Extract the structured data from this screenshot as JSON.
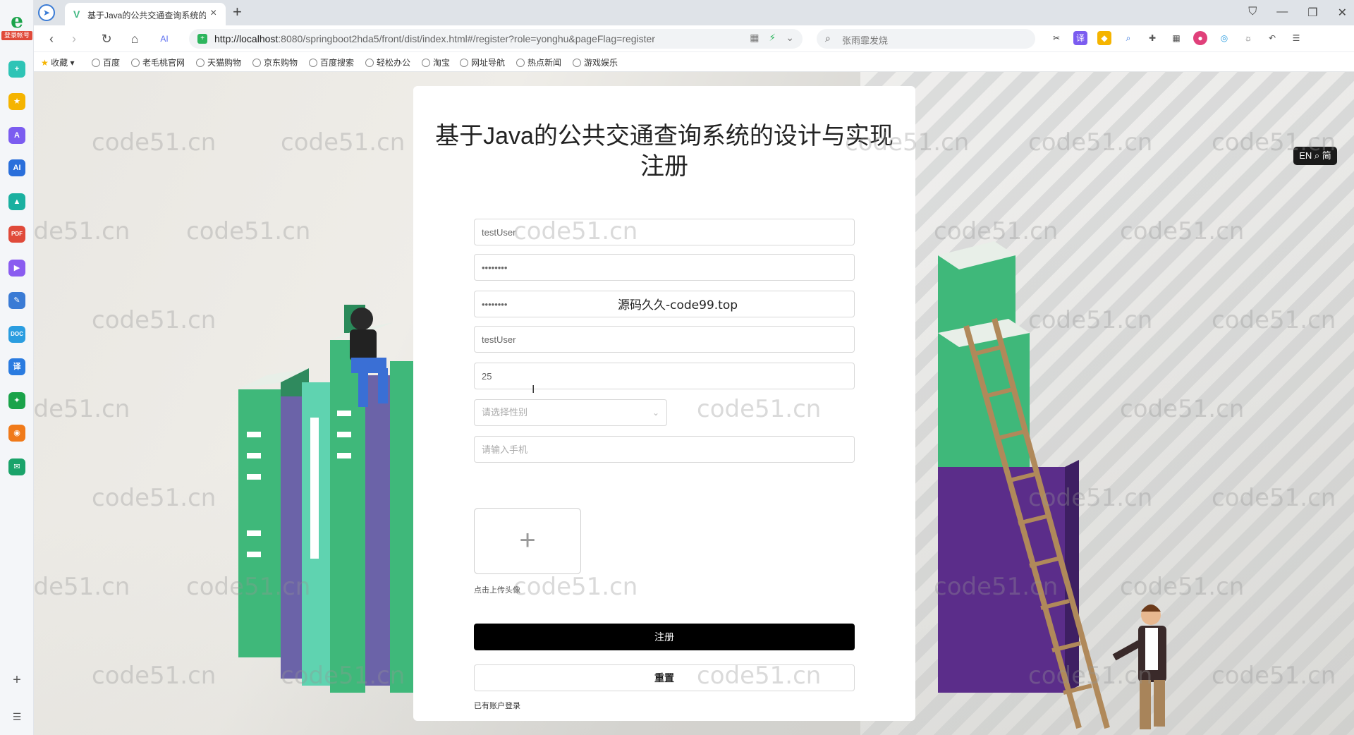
{
  "browser": {
    "sidebar_login_badge": "登录帐号",
    "tab_title": "基于Java的公共交通查询系统的",
    "url_host": "http://localhost",
    "url_rest": ":8080/springboot2hda5/front/dist/index.html#/register?role=yonghu&pageFlag=register",
    "search_query": "张雨霏发烧",
    "bookmarks": [
      "收藏",
      "百度",
      "老毛桃官网",
      "天猫购物",
      "京东购物",
      "百度搜索",
      "轻松办公",
      "淘宝",
      "网址导航",
      "热点新闻",
      "游戏娱乐"
    ]
  },
  "page": {
    "title_line1": "基于Java的公共交通查询系统的设计与实现",
    "title_line2": "注册",
    "lang_badge": "EN ⌕ 简",
    "fields": {
      "account_value": "testUser",
      "password_value": "••••••••",
      "confirm_password_value": "••••••••",
      "name_value": "testUser",
      "age_value": "25",
      "gender_placeholder": "请选择性别",
      "phone_placeholder": "请输入手机"
    },
    "upload_label": "点击上传头像",
    "register_button": "注册",
    "reset_button": "重置",
    "login_link": "已有账户登录",
    "overlay_text": "源码久久-code99.top",
    "watermark_text": "code51.cn"
  }
}
